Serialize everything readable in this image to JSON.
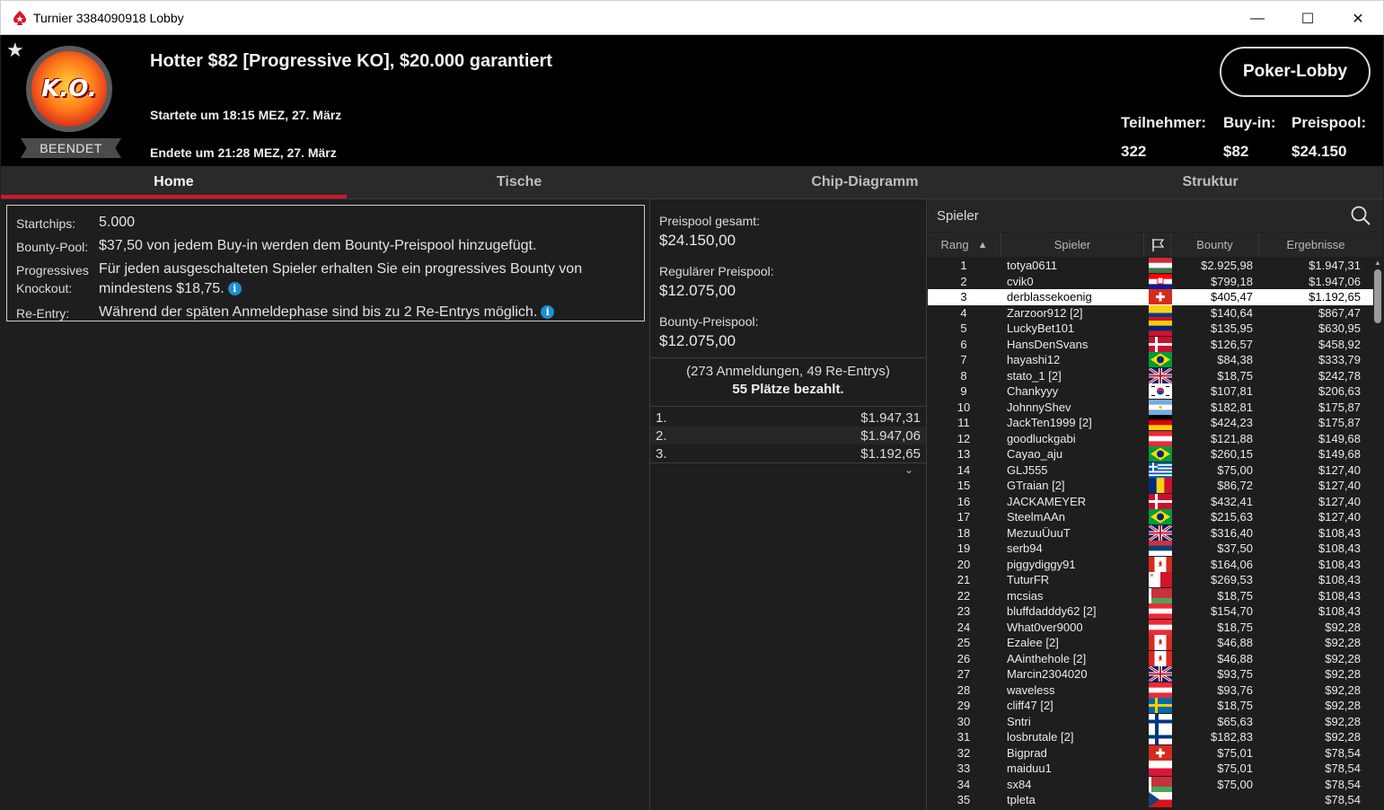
{
  "window": {
    "title": "Turnier 3384090918 Lobby",
    "minimize": "—",
    "maximize": "☐",
    "close": "✕"
  },
  "header": {
    "status": "BEENDET",
    "logo_text": "K.O.",
    "title": "Hotter $82 [Progressive KO], $20.000 garantiert",
    "start": "Startete um 18:15 MEZ, 27. März",
    "end": "Endete um 21:28 MEZ, 27. März",
    "lobby_button": "Poker-Lobby",
    "stats": [
      {
        "label": "Teilnehmer:",
        "value": "322"
      },
      {
        "label": "Buy-in:",
        "value": "$82"
      },
      {
        "label": "Preispool:",
        "value": "$24.150"
      }
    ]
  },
  "tabs": [
    {
      "label": "Home",
      "active": true
    },
    {
      "label": "Tische",
      "active": false
    },
    {
      "label": "Chip-Diagramm",
      "active": false
    },
    {
      "label": "Struktur",
      "active": false
    }
  ],
  "info": {
    "startchips_label": "Startchips:",
    "startchips_value": "5.000",
    "bountypool_label": "Bounty-Pool:",
    "bountypool_value": "$37,50 von jedem Buy-in werden dem Bounty-Preispool hinzugefügt.",
    "progressive_label": "Progressives Knockout:",
    "progressive_value": "Für jeden ausgeschalteten Spieler erhalten Sie ein progressives Bounty von mindestens $18,75.",
    "reentry_label": "Re-Entry:",
    "reentry_value": "Während der späten Anmeldephase sind bis zu 2 Re-Entrys möglich."
  },
  "prizepool": {
    "total_label": "Preispool gesamt:",
    "total_value": "$24.150,00",
    "regular_label": "Regulärer Preispool:",
    "regular_value": "$12.075,00",
    "bounty_label": "Bounty-Preispool:",
    "bounty_value": "$12.075,00",
    "registrations": "(273 Anmeldungen, 49 Re-Entrys)",
    "paid_places": "55 Plätze bezahlt.",
    "payouts": [
      {
        "place": "1.",
        "amount": "$1.947,31"
      },
      {
        "place": "2.",
        "amount": "$1.947,06"
      },
      {
        "place": "3.",
        "amount": "$1.192,65"
      }
    ]
  },
  "players_panel": {
    "search_placeholder": "Spieler",
    "columns": {
      "rank": "Rang",
      "player": "Spieler",
      "bounty": "Bounty",
      "result": "Ergebnisse"
    },
    "highlight_rank": "3",
    "rows": [
      {
        "rank": "1",
        "name": "totya0611",
        "flag": "hungary",
        "bounty": "$2.925,98",
        "result": "$1.947,31"
      },
      {
        "rank": "2",
        "name": "cvik0",
        "flag": "croatia",
        "bounty": "$799,18",
        "result": "$1.947,06"
      },
      {
        "rank": "3",
        "name": "derblassekoenig",
        "flag": "switzerland",
        "bounty": "$405,47",
        "result": "$1.192,65"
      },
      {
        "rank": "4",
        "name": "Zarzoor912 [2]",
        "flag": "colombia",
        "bounty": "$140,64",
        "result": "$867,47"
      },
      {
        "rank": "5",
        "name": "LuckyBet101",
        "flag": "venezuela",
        "bounty": "$135,95",
        "result": "$630,95"
      },
      {
        "rank": "6",
        "name": "HansDenSvans",
        "flag": "denmark",
        "bounty": "$126,57",
        "result": "$458,92"
      },
      {
        "rank": "7",
        "name": "hayashi12",
        "flag": "brazil",
        "bounty": "$84,38",
        "result": "$333,79"
      },
      {
        "rank": "8",
        "name": "stato_1 [2]",
        "flag": "uk",
        "bounty": "$18,75",
        "result": "$242,78"
      },
      {
        "rank": "9",
        "name": "Chankyyy",
        "flag": "korea",
        "bounty": "$107,81",
        "result": "$206,63"
      },
      {
        "rank": "10",
        "name": "JohnnyShev",
        "flag": "argentina",
        "bounty": "$182,81",
        "result": "$175,87"
      },
      {
        "rank": "11",
        "name": "JackTen1999 [2]",
        "flag": "germany",
        "bounty": "$424,23",
        "result": "$175,87"
      },
      {
        "rank": "12",
        "name": "goodluckgabi",
        "flag": "austria",
        "bounty": "$121,88",
        "result": "$149,68"
      },
      {
        "rank": "13",
        "name": "Cayao_aju",
        "flag": "brazil",
        "bounty": "$260,15",
        "result": "$149,68"
      },
      {
        "rank": "14",
        "name": "GLJ555",
        "flag": "greece",
        "bounty": "$75,00",
        "result": "$127,40"
      },
      {
        "rank": "15",
        "name": "GTraian [2]",
        "flag": "romania",
        "bounty": "$86,72",
        "result": "$127,40"
      },
      {
        "rank": "16",
        "name": "JACKAMEYER",
        "flag": "denmark",
        "bounty": "$432,41",
        "result": "$127,40"
      },
      {
        "rank": "17",
        "name": "SteelmAAn",
        "flag": "brazil",
        "bounty": "$215,63",
        "result": "$127,40"
      },
      {
        "rank": "18",
        "name": "MezuuÜuuT",
        "flag": "uk",
        "bounty": "$316,40",
        "result": "$108,43"
      },
      {
        "rank": "19",
        "name": "serb94",
        "flag": "serbia",
        "bounty": "$37,50",
        "result": "$108,43"
      },
      {
        "rank": "20",
        "name": "piggydiggy91",
        "flag": "canada",
        "bounty": "$164,06",
        "result": "$108,43"
      },
      {
        "rank": "21",
        "name": "TuturFR",
        "flag": "malta",
        "bounty": "$269,53",
        "result": "$108,43"
      },
      {
        "rank": "22",
        "name": "mcsias",
        "flag": "belarus",
        "bounty": "$18,75",
        "result": "$108,43"
      },
      {
        "rank": "23",
        "name": "bluffdadddy62 [2]",
        "flag": "austria",
        "bounty": "$154,70",
        "result": "$108,43"
      },
      {
        "rank": "24",
        "name": "What0ver9000",
        "flag": "austria",
        "bounty": "$18,75",
        "result": "$92,28"
      },
      {
        "rank": "25",
        "name": "Ezalee [2]",
        "flag": "canada",
        "bounty": "$46,88",
        "result": "$92,28"
      },
      {
        "rank": "26",
        "name": "AAinthehole [2]",
        "flag": "canada",
        "bounty": "$46,88",
        "result": "$92,28"
      },
      {
        "rank": "27",
        "name": "Marcin2304020",
        "flag": "uk",
        "bounty": "$93,75",
        "result": "$92,28"
      },
      {
        "rank": "28",
        "name": "waveless",
        "flag": "austria",
        "bounty": "$93,76",
        "result": "$92,28"
      },
      {
        "rank": "29",
        "name": "cliff47 [2]",
        "flag": "sweden",
        "bounty": "$18,75",
        "result": "$92,28"
      },
      {
        "rank": "30",
        "name": "Sntri",
        "flag": "finland",
        "bounty": "$65,63",
        "result": "$92,28"
      },
      {
        "rank": "31",
        "name": "losbrutale [2]",
        "flag": "finland",
        "bounty": "$182,83",
        "result": "$92,28"
      },
      {
        "rank": "32",
        "name": "Bigprad",
        "flag": "switzerland",
        "bounty": "$75,01",
        "result": "$78,54"
      },
      {
        "rank": "33",
        "name": "maiduu1",
        "flag": "poland",
        "bounty": "$75,01",
        "result": "$78,54"
      },
      {
        "rank": "34",
        "name": "sx84",
        "flag": "belarus",
        "bounty": "$75,00",
        "result": "$78,54"
      },
      {
        "rank": "35",
        "name": "tpleta",
        "flag": "czech",
        "bounty": "",
        "result": "$78,54"
      }
    ]
  },
  "colors": {
    "accent_red": "#d3152a",
    "background": "#1f1f1f",
    "header_bg": "#000000",
    "info_icon": "#1b8fd1"
  }
}
